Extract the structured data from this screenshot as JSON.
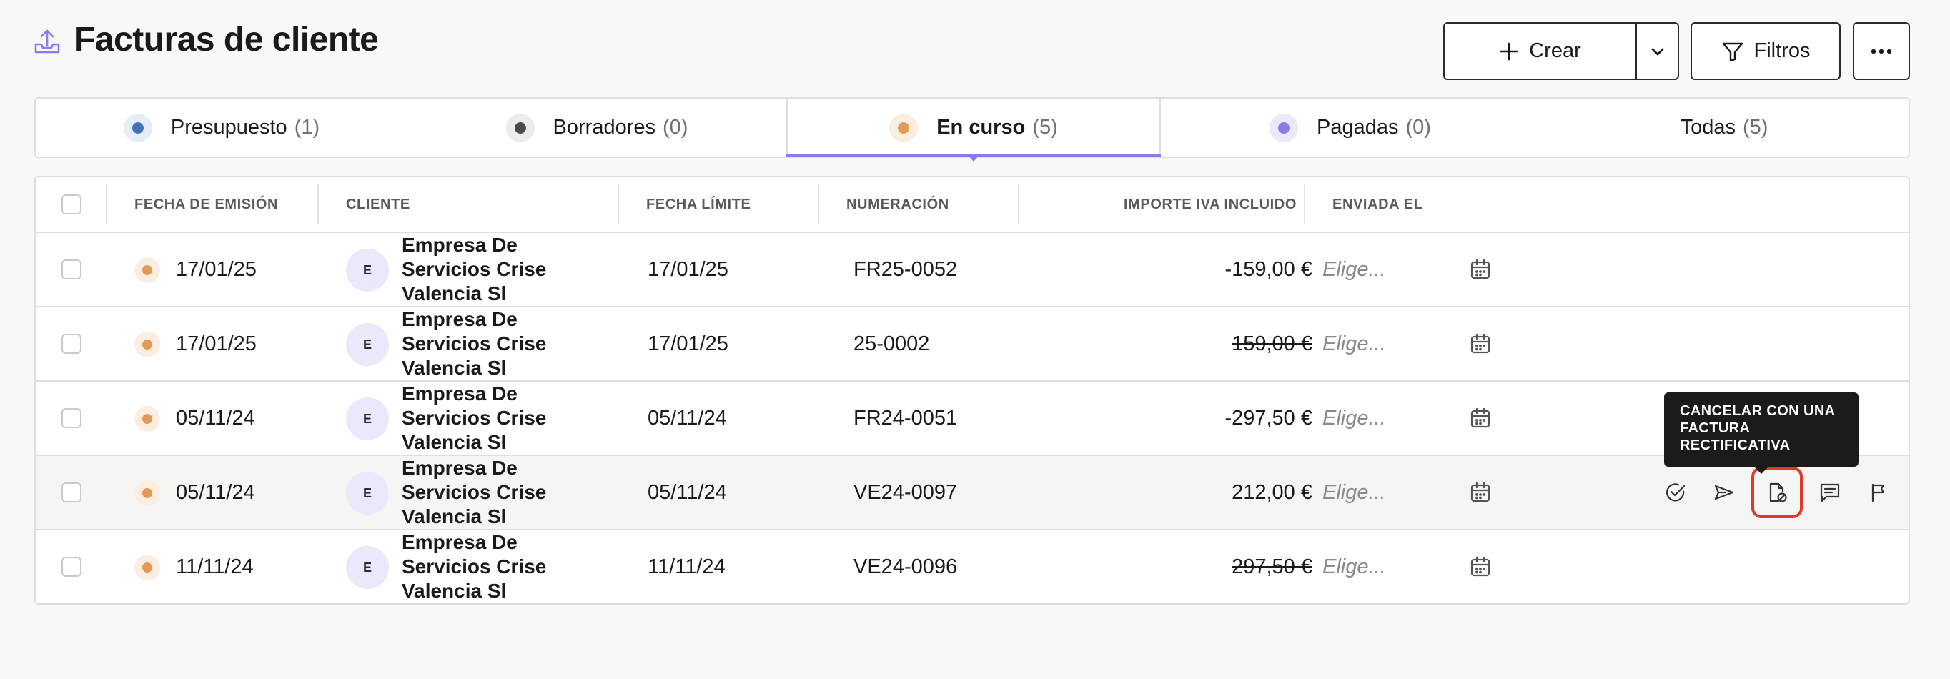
{
  "header": {
    "title": "Facturas de cliente",
    "icon": "upload-tray-icon"
  },
  "toolbar": {
    "crear_label": "Crear",
    "filtros_label": "Filtros"
  },
  "tabs": [
    {
      "label": "Presupuesto",
      "count": "(1)",
      "dot_color": "#3f73b3",
      "dot_bg": "#e5edf7"
    },
    {
      "label": "Borradores",
      "count": "(0)",
      "dot_color": "#4a4a4a",
      "dot_bg": "#ececec"
    },
    {
      "label": "En curso",
      "count": "(5)",
      "dot_color": "#e29a55",
      "dot_bg": "#fbeee0",
      "active": true
    },
    {
      "label": "Pagadas",
      "count": "(0)",
      "dot_color": "#8c7be8",
      "dot_bg": "#ece8fb"
    },
    {
      "label": "Todas",
      "count": "(5)"
    }
  ],
  "table": {
    "columns": [
      "FECHA DE EMISIÓN",
      "CLIENTE",
      "FECHA LÍMITE",
      "NUMERACIÓN",
      "IMPORTE IVA INCLUIDO",
      "ENVIADA EL"
    ],
    "rows": [
      {
        "emision": "17/01/25",
        "avatar": "E",
        "cliente": "Empresa De Servicios Crise Valencia Sl",
        "limite": "17/01/25",
        "numeracion": "FR25-0052",
        "importe": "-159,00 €",
        "strike": false,
        "enviada": "Elige..."
      },
      {
        "emision": "17/01/25",
        "avatar": "E",
        "cliente": "Empresa De Servicios Crise Valencia Sl",
        "limite": "17/01/25",
        "numeracion": "25-0002",
        "importe": "159,00 €",
        "strike": true,
        "enviada": "Elige..."
      },
      {
        "emision": "05/11/24",
        "avatar": "E",
        "cliente": "Empresa De Servicios Crise Valencia Sl",
        "limite": "05/11/24",
        "numeracion": "FR24-0051",
        "importe": "-297,50 €",
        "strike": false,
        "enviada": "Elige..."
      },
      {
        "emision": "05/11/24",
        "avatar": "E",
        "cliente": "Empresa De Servicios Crise Valencia Sl",
        "limite": "05/11/24",
        "numeracion": "VE24-0097",
        "importe": "212,00 €",
        "strike": false,
        "enviada": "Elige...",
        "hover": true
      },
      {
        "emision": "11/11/24",
        "avatar": "E",
        "cliente": "Empresa De Servicios Crise Valencia Sl",
        "limite": "11/11/24",
        "numeracion": "VE24-0096",
        "importe": "297,50 €",
        "strike": true,
        "enviada": "Elige..."
      }
    ]
  },
  "row_actions": [
    "check-circle-icon",
    "send-icon",
    "document-cancel-icon",
    "comment-icon",
    "flag-icon"
  ],
  "tooltip": {
    "text": "CANCELAR CON UNA FACTURA RECTIFICATIVA"
  },
  "colors": {
    "accent": "#8c7be8",
    "status_en_curso": "#e29a55",
    "highlight": "#e0392b"
  }
}
